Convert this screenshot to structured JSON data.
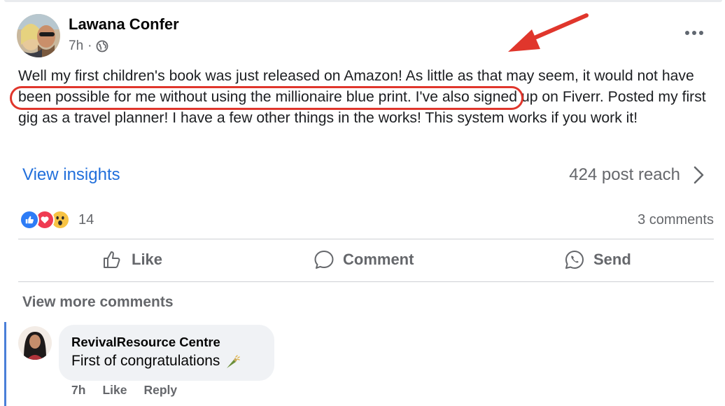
{
  "post": {
    "author": "Lawana Confer",
    "time": "7h",
    "separator": "·",
    "text_part1": "Well my first children's book was just released on Amazon! As little as that may seem, it would ",
    "text_circled": "not have been possible for me without using the millionaire blue print.",
    "text_part2": " I've also signed up on Fiverr. Posted my first gig as a travel planner! I have a few other things in the works! This system works if you work it!",
    "more_icon": "more-horizontal-icon"
  },
  "insights": {
    "link": "View insights",
    "reach": "424 post reach"
  },
  "reactions": {
    "count": "14",
    "comments": "3 comments"
  },
  "actions": {
    "like": "Like",
    "comment": "Comment",
    "send": "Send"
  },
  "comments_section": {
    "view_more": "View more comments",
    "comment": {
      "author": "RevivalResource Centre",
      "text": "First of congratulations",
      "time": "7h",
      "like": "Like",
      "reply": "Reply"
    }
  },
  "colors": {
    "link": "#216fdb",
    "annotation": "#e0362c",
    "like_reaction": "#2d7cf6",
    "love_reaction": "#ef3b52",
    "wow_reaction": "#f7c344"
  }
}
